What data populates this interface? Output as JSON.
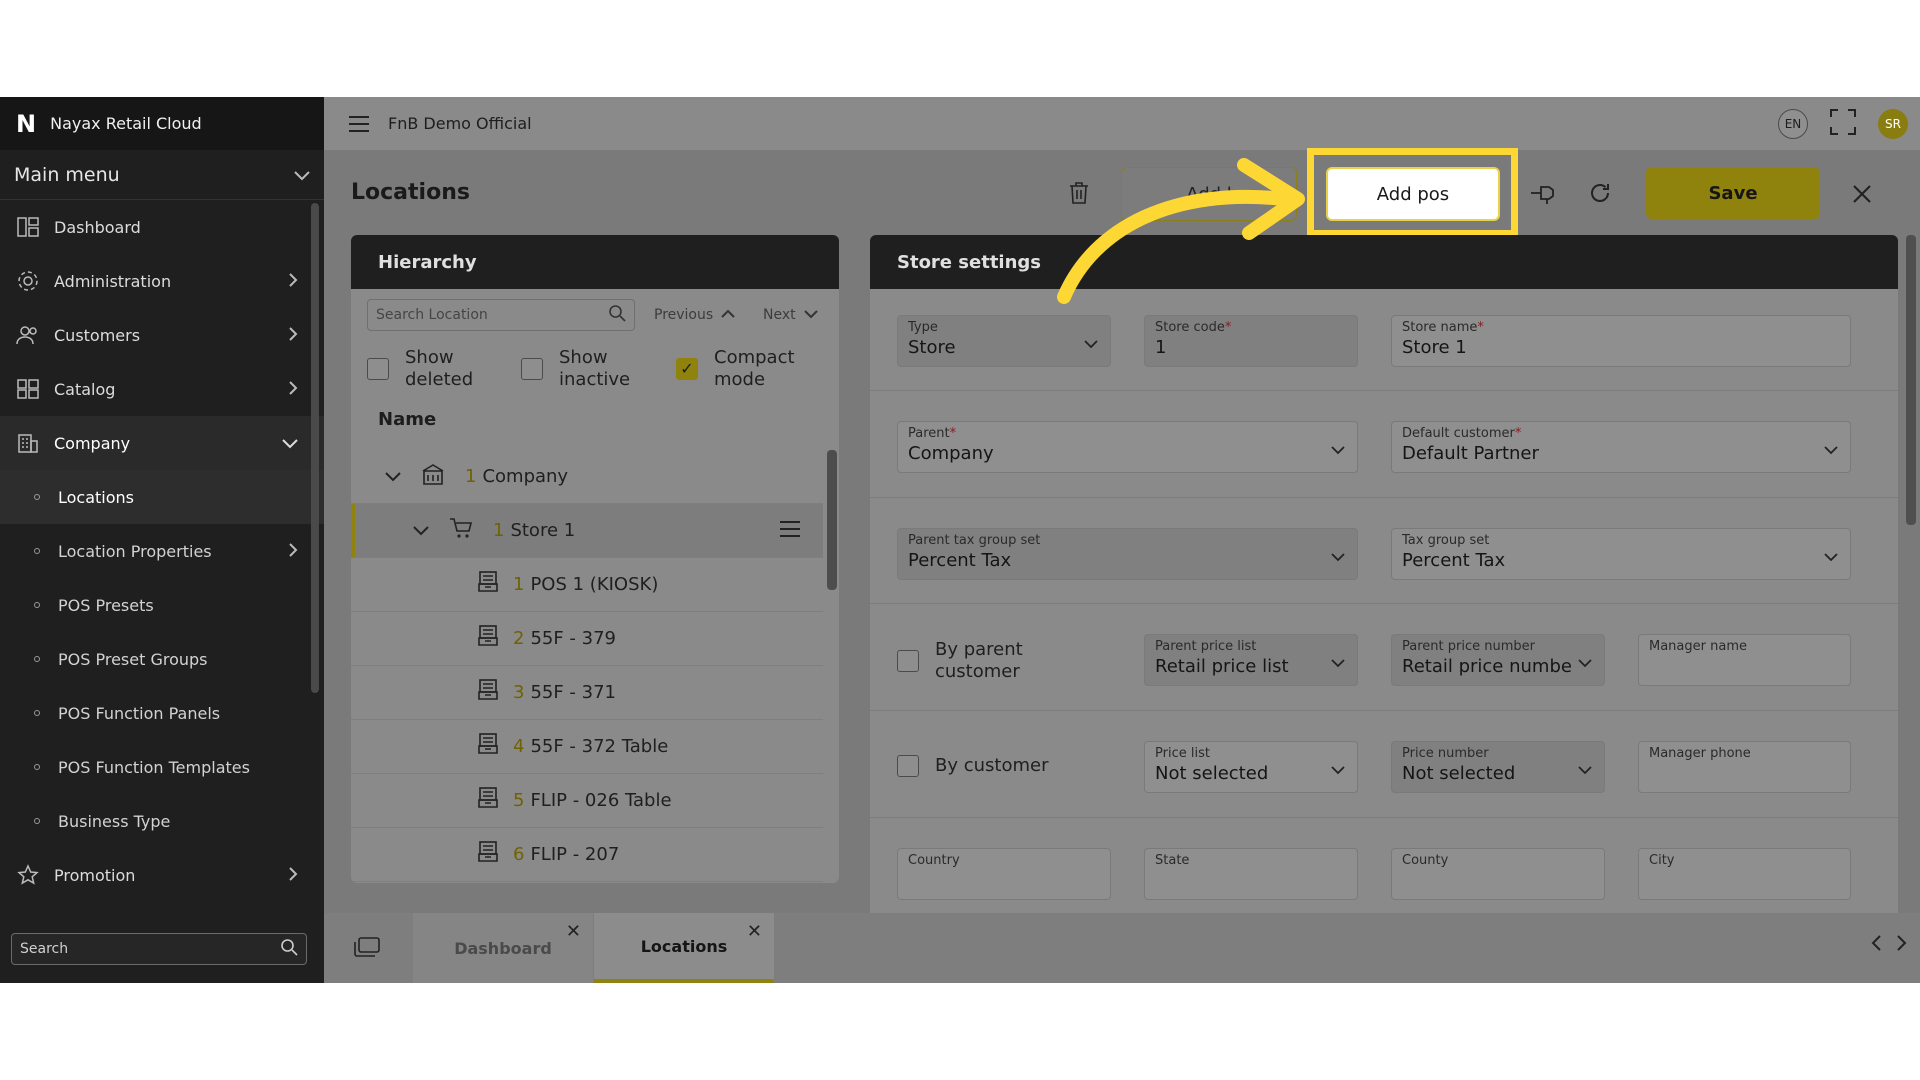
{
  "app": {
    "brand_logo": "N",
    "brand_name": "Nayax Retail Cloud",
    "workspace": "FnB Demo Official",
    "lang": "EN",
    "user_initials": "SR"
  },
  "sidebar": {
    "main_menu": "Main menu",
    "items": [
      {
        "label": "Dashboard",
        "icon": "dashboard-icon"
      },
      {
        "label": "Administration",
        "icon": "gear-icon"
      },
      {
        "label": "Customers",
        "icon": "users-icon"
      },
      {
        "label": "Catalog",
        "icon": "grid-icon"
      },
      {
        "label": "Company",
        "icon": "building-icon"
      }
    ],
    "subitems": [
      {
        "label": "Locations"
      },
      {
        "label": "Location Properties"
      },
      {
        "label": "POS Presets"
      },
      {
        "label": "POS Preset Groups"
      },
      {
        "label": "POS Function Panels"
      },
      {
        "label": "POS Function Templates"
      },
      {
        "label": "Business Type"
      }
    ],
    "promotion": "Promotion",
    "search_placeholder": "Search"
  },
  "page": {
    "title": "Locations",
    "add_location_label": "Add l",
    "add_pos_label": "Add pos",
    "save_label": "Save"
  },
  "hierarchy": {
    "title": "Hierarchy",
    "search_placeholder": "Search Location",
    "previous": "Previous",
    "next": "Next",
    "show_deleted": "Show deleted",
    "show_inactive": "Show inactive",
    "compact_mode": "Compact mode",
    "column_name": "Name",
    "rows": [
      {
        "num": "1",
        "label": "Company"
      },
      {
        "num": "1",
        "label": "Store 1"
      },
      {
        "num": "1",
        "label": "POS 1 (KIOSK)"
      },
      {
        "num": "2",
        "label": "55F - 379"
      },
      {
        "num": "3",
        "label": "55F - 371"
      },
      {
        "num": "4",
        "label": "55F - 372 Table"
      },
      {
        "num": "5",
        "label": "FLIP - 026 Table"
      },
      {
        "num": "6",
        "label": "FLIP - 207"
      }
    ]
  },
  "settings": {
    "title": "Store settings",
    "type": {
      "label": "Type",
      "value": "Store"
    },
    "store_code": {
      "label": "Store code",
      "value": "1"
    },
    "store_name": {
      "label": "Store name",
      "value": "Store 1"
    },
    "parent": {
      "label": "Parent",
      "value": "Company"
    },
    "default_customer": {
      "label": "Default customer",
      "value": "Default Partner"
    },
    "parent_tax_group_set": {
      "label": "Parent tax group set",
      "value": "Percent Tax"
    },
    "tax_group_set": {
      "label": "Tax group set",
      "value": "Percent Tax"
    },
    "by_parent_customer": "By parent customer",
    "parent_price_list": {
      "label": "Parent price list",
      "value": "Retail price list"
    },
    "parent_price_number": {
      "label": "Parent price number",
      "value": "Retail price numbe"
    },
    "manager_name": {
      "label": "Manager name",
      "value": ""
    },
    "by_customer": "By customer",
    "price_list": {
      "label": "Price list",
      "value": "Not selected"
    },
    "price_number": {
      "label": "Price number",
      "value": "Not selected"
    },
    "manager_phone": {
      "label": "Manager phone",
      "value": ""
    },
    "country": {
      "label": "Country"
    },
    "state": {
      "label": "State"
    },
    "county": {
      "label": "County"
    },
    "city": {
      "label": "City"
    }
  },
  "tabs": [
    {
      "label": "Dashboard",
      "active": false
    },
    {
      "label": "Locations",
      "active": true
    }
  ],
  "colors": {
    "accent": "#fdd834",
    "save": "#8f830d",
    "sidebar": "#1f1f1f"
  }
}
